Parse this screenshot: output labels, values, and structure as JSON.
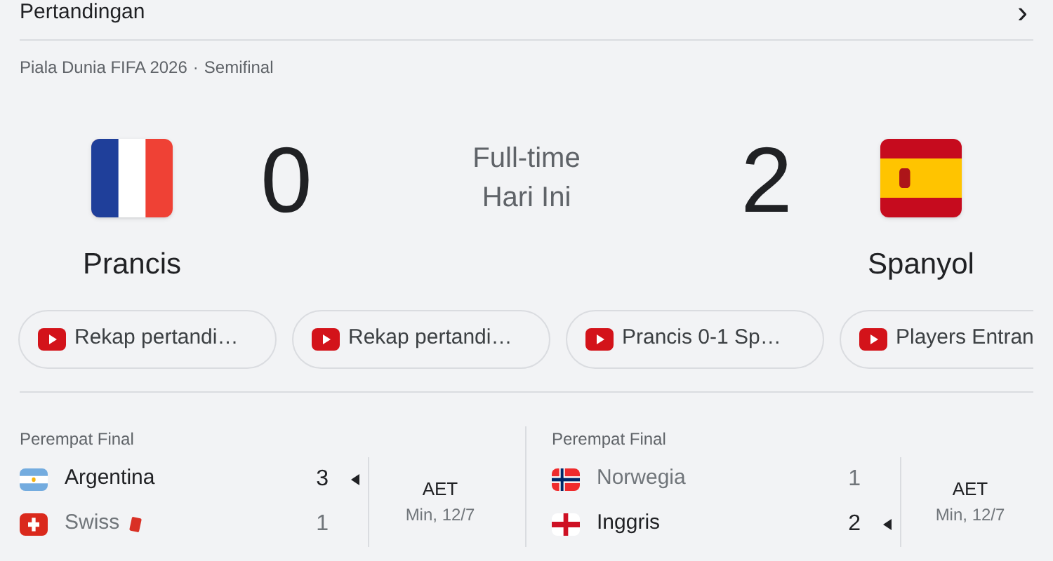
{
  "header": {
    "title": "Pertandingan",
    "chevron": "›"
  },
  "competition": {
    "name": "Piala Dunia FIFA 2026",
    "separator": "·",
    "stage": "Semifinal"
  },
  "match": {
    "home": {
      "name": "Prancis",
      "kind": "france",
      "score": "0"
    },
    "status": "Full-time",
    "date": "Hari Ini",
    "away": {
      "name": "Spanyol",
      "kind": "spain",
      "score": "2"
    }
  },
  "videos": [
    {
      "title": "Rekap pertandi…"
    },
    {
      "title": "Rekap pertandi…"
    },
    {
      "title": "Prancis 0-1 Sp…"
    },
    {
      "title": "Players Entran"
    }
  ],
  "other_matches": [
    {
      "stage": "Perempat Final",
      "status": "AET",
      "date": "Min, 12/7",
      "teams": [
        {
          "name": "Argentina",
          "kind": "argentina",
          "score": "3",
          "winner": true,
          "red_card": false
        },
        {
          "name": "Swiss",
          "kind": "switzerland",
          "score": "1",
          "winner": false,
          "red_card": true
        }
      ]
    },
    {
      "stage": "Perempat Final",
      "status": "AET",
      "date": "Min, 12/7",
      "teams": [
        {
          "name": "Norwegia",
          "kind": "norway",
          "score": "1",
          "winner": false,
          "red_card": false
        },
        {
          "name": "Inggris",
          "kind": "england",
          "score": "2",
          "winner": true,
          "red_card": false
        }
      ]
    }
  ]
}
